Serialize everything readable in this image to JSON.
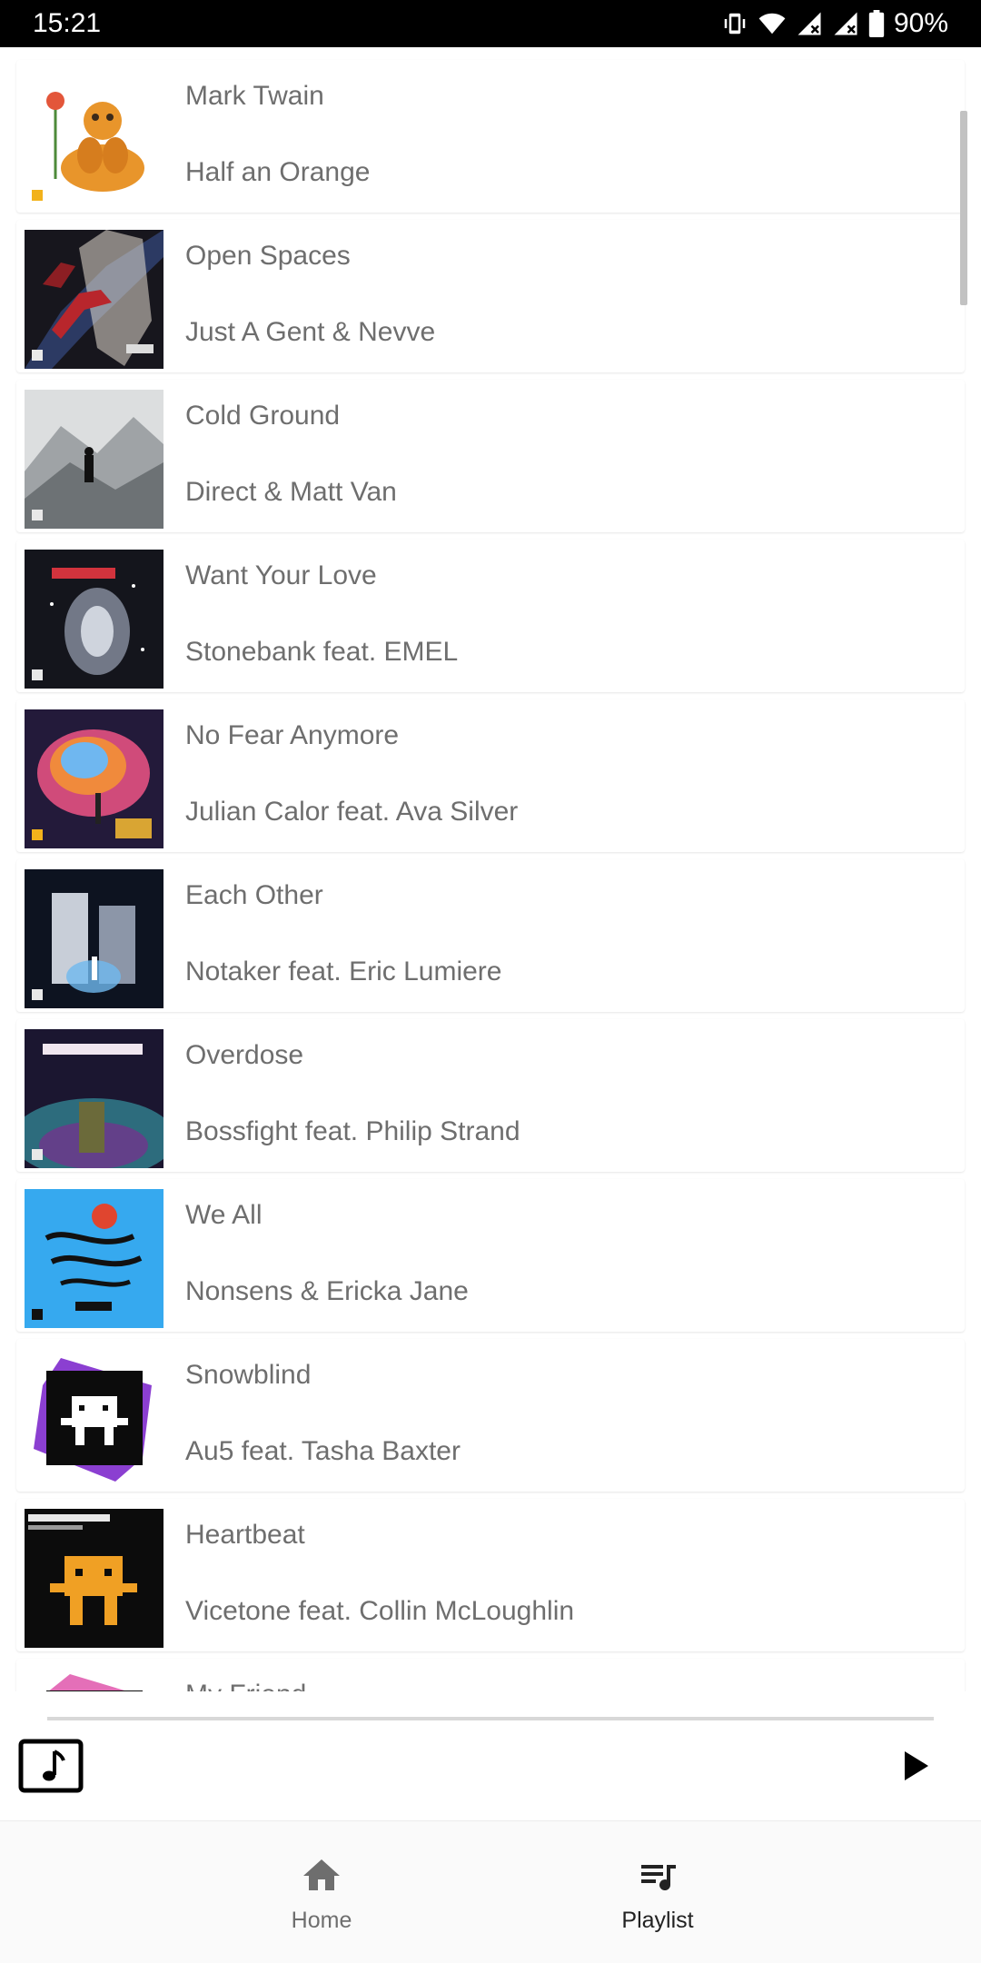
{
  "status_bar": {
    "time": "15:21",
    "battery": "90%",
    "icons": [
      "vibrate-icon",
      "wifi-icon",
      "signal-icon",
      "signal-icon",
      "battery-icon"
    ]
  },
  "tracks": [
    {
      "title": "Mark Twain",
      "artist": "Half an Orange"
    },
    {
      "title": "Open Spaces",
      "artist": "Just A Gent & Nevve"
    },
    {
      "title": "Cold Ground",
      "artist": "Direct & Matt Van"
    },
    {
      "title": "Want Your Love",
      "artist": "Stonebank feat. EMEL"
    },
    {
      "title": "No Fear Anymore",
      "artist": "Julian Calor feat. Ava Silver"
    },
    {
      "title": "Each Other",
      "artist": "Notaker feat. Eric Lumiere"
    },
    {
      "title": "Overdose",
      "artist": "Bossfight feat. Philip Strand"
    },
    {
      "title": "We All",
      "artist": "Nonsens & Ericka Jane"
    },
    {
      "title": "Snowblind",
      "artist": "Au5 feat. Tasha Baxter"
    },
    {
      "title": "Heartbeat",
      "artist": "Vicetone feat. Collin McLoughlin"
    },
    {
      "title": "My Friend",
      "artist": ""
    }
  ],
  "player": {
    "art_icon": "music-note-icon",
    "play_icon": "play-icon",
    "progress": 0
  },
  "bottom_nav": {
    "items": [
      {
        "label": "Home",
        "icon": "home-icon",
        "active": false
      },
      {
        "label": "Playlist",
        "icon": "playlist-icon",
        "active": true
      }
    ]
  },
  "colors": {
    "text_secondary": "#6e6e6e",
    "nav_active": "#222222",
    "status_bar_bg": "#000000"
  }
}
